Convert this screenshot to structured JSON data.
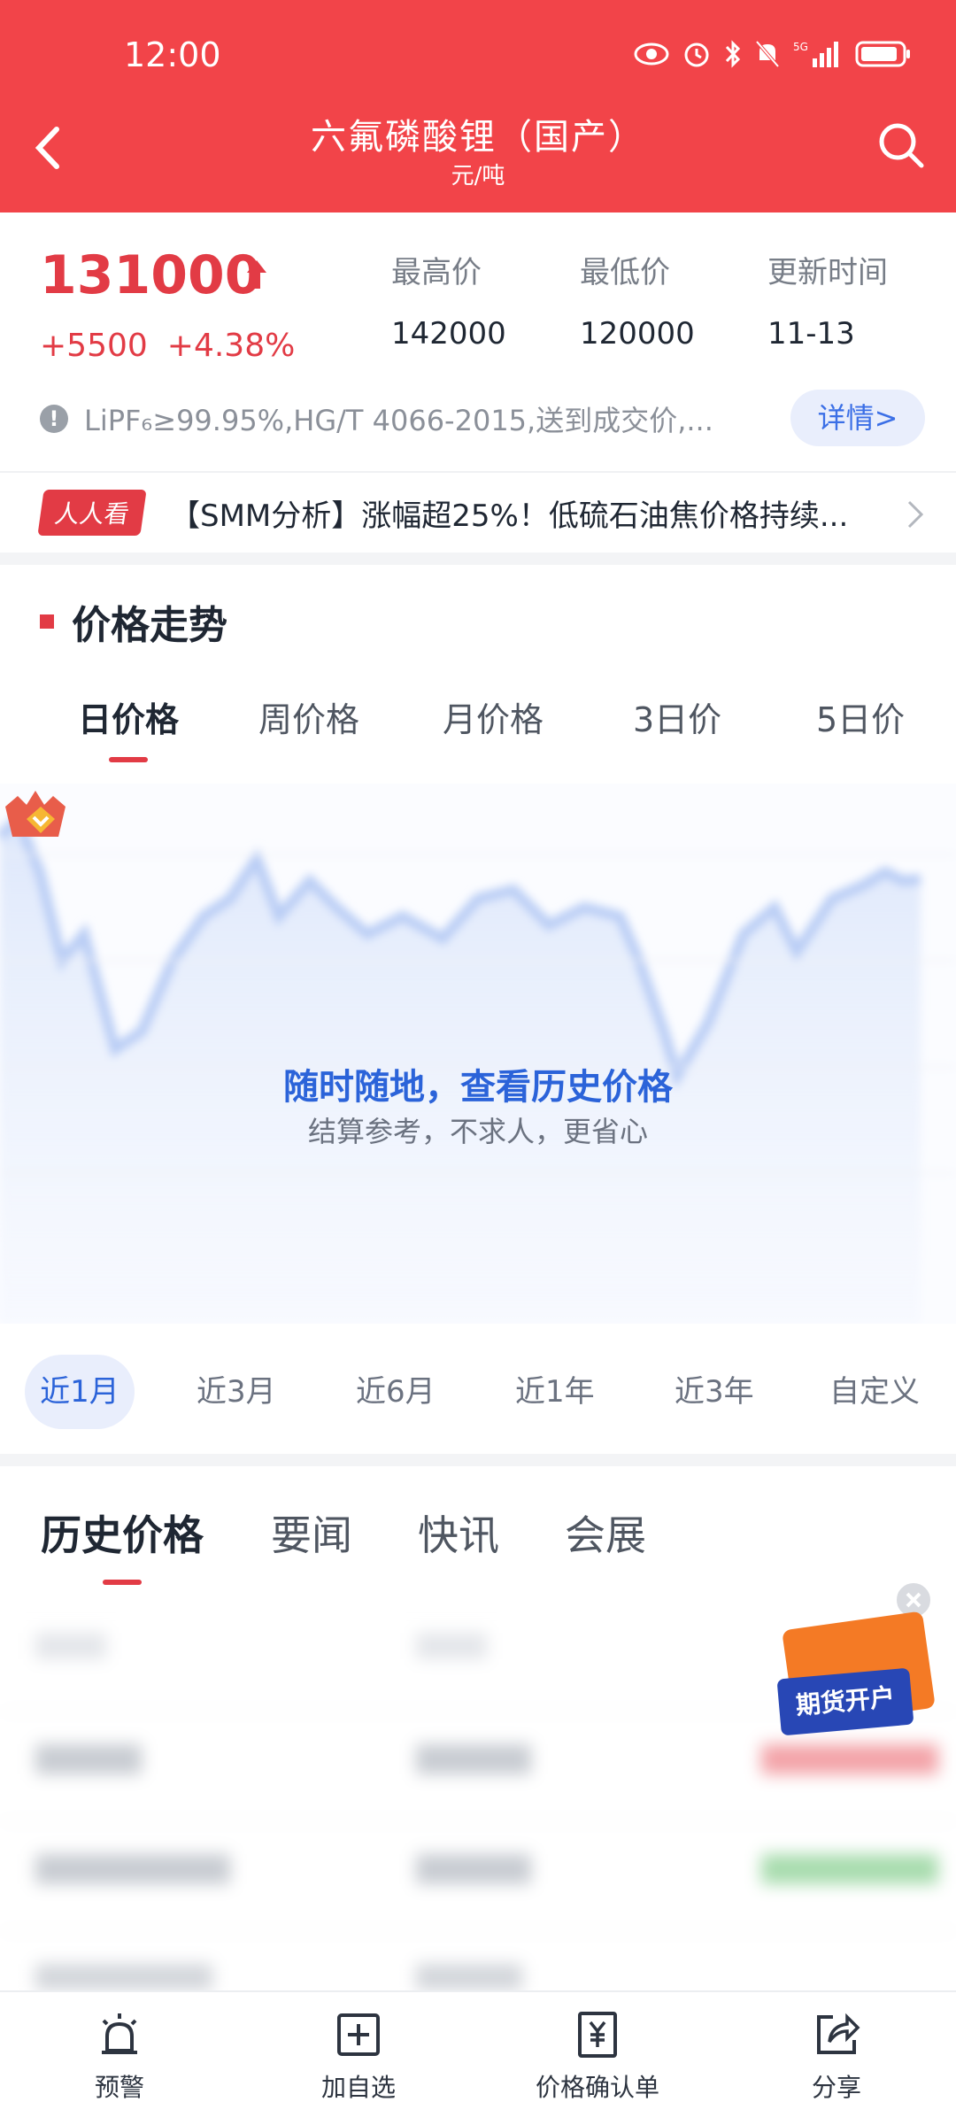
{
  "status_bar": {
    "time": "12:00",
    "icons": [
      "eye-icon",
      "alarm-icon",
      "bluetooth-icon",
      "mute-icon",
      "signal-5g-icon",
      "battery-icon"
    ]
  },
  "header": {
    "title": "六氟磷酸锂（国产）",
    "unit": "元/吨"
  },
  "price": {
    "value": "131000",
    "change_abs": "+5500",
    "change_pct": "+4.38%",
    "stats": [
      {
        "label": "最高价",
        "value": "142000"
      },
      {
        "label": "最低价",
        "value": "120000"
      },
      {
        "label": "更新时间",
        "value": "11-13"
      }
    ],
    "spec": "LiPF₆≥99.95%,HG/T 4066-2015,送到成交价,...",
    "detail_label": "详情>"
  },
  "news": {
    "badge": "人人看",
    "text": "【SMM分析】涨幅超25%！低硫石油焦价格持续..."
  },
  "trend": {
    "title": "价格走势",
    "tabs": [
      "日价格",
      "周价格",
      "月价格",
      "3日价",
      "5日价"
    ],
    "active_tab": 0,
    "overlay_title": "随时随地，查看历史价格",
    "overlay_subtitle": "结算参考，不求人，更省心"
  },
  "ranges": {
    "items": [
      "近1月",
      "近3月",
      "近6月",
      "近1年",
      "近3年",
      "自定义"
    ],
    "active": 0
  },
  "bottom_tabs": {
    "items": [
      "历史价格",
      "要闻",
      "快讯",
      "会展"
    ],
    "active": 0
  },
  "promo": {
    "label": "期货开户"
  },
  "nav": [
    {
      "label": "预警",
      "icon": "alarm-bell-icon"
    },
    {
      "label": "加自选",
      "icon": "add-watchlist-icon"
    },
    {
      "label": "价格确认单",
      "icon": "yuan-receipt-icon"
    },
    {
      "label": "分享",
      "icon": "share-icon"
    }
  ],
  "colors": {
    "brand_red": "#f24449",
    "price_red": "#e23b45",
    "accent_blue": "#2b63d9"
  }
}
